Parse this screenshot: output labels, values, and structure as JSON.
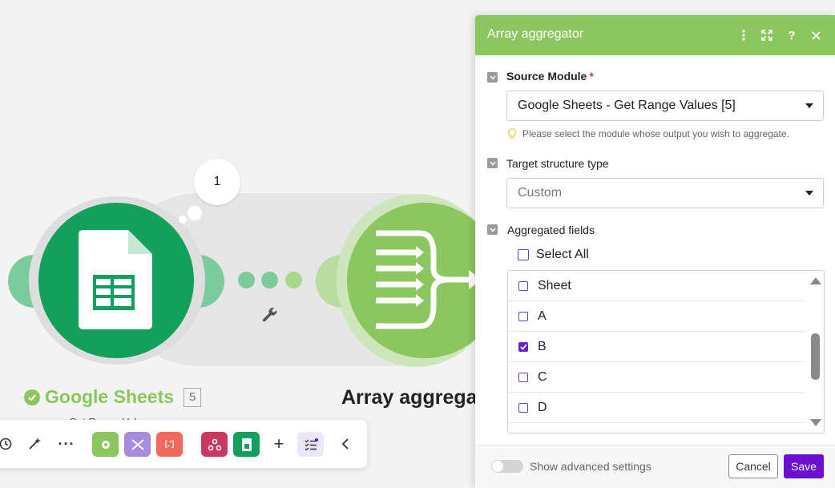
{
  "scenario": {
    "bubble_count": "1",
    "google_sheets": {
      "title": "Google Sheets",
      "module_number": "5",
      "subtitle": "Get Range Values"
    },
    "array_aggregator": {
      "title": "Array aggregator"
    }
  },
  "panel": {
    "title": "Array aggregator",
    "source_module": {
      "label": "Source Module",
      "required_mark": "*",
      "value": "Google Sheets - Get Range Values [5]",
      "hint": "Please select the module whose output you wish to aggregate."
    },
    "target_structure": {
      "label": "Target structure type",
      "value": "Custom"
    },
    "aggregated_fields": {
      "label": "Aggregated fields",
      "select_all_label": "Select All",
      "items": [
        {
          "label": "Sheet",
          "checked": false
        },
        {
          "label": "A",
          "checked": false
        },
        {
          "label": "B",
          "checked": true
        },
        {
          "label": "C",
          "checked": false
        },
        {
          "label": "D",
          "checked": false
        }
      ]
    },
    "footer": {
      "advanced_label": "Show advanced settings",
      "cancel_label": "Cancel",
      "save_label": "Save"
    }
  },
  "colors": {
    "accent_green": "#8cc65f",
    "sheets_green": "#12a05c",
    "save_purple": "#6a0fd1"
  }
}
